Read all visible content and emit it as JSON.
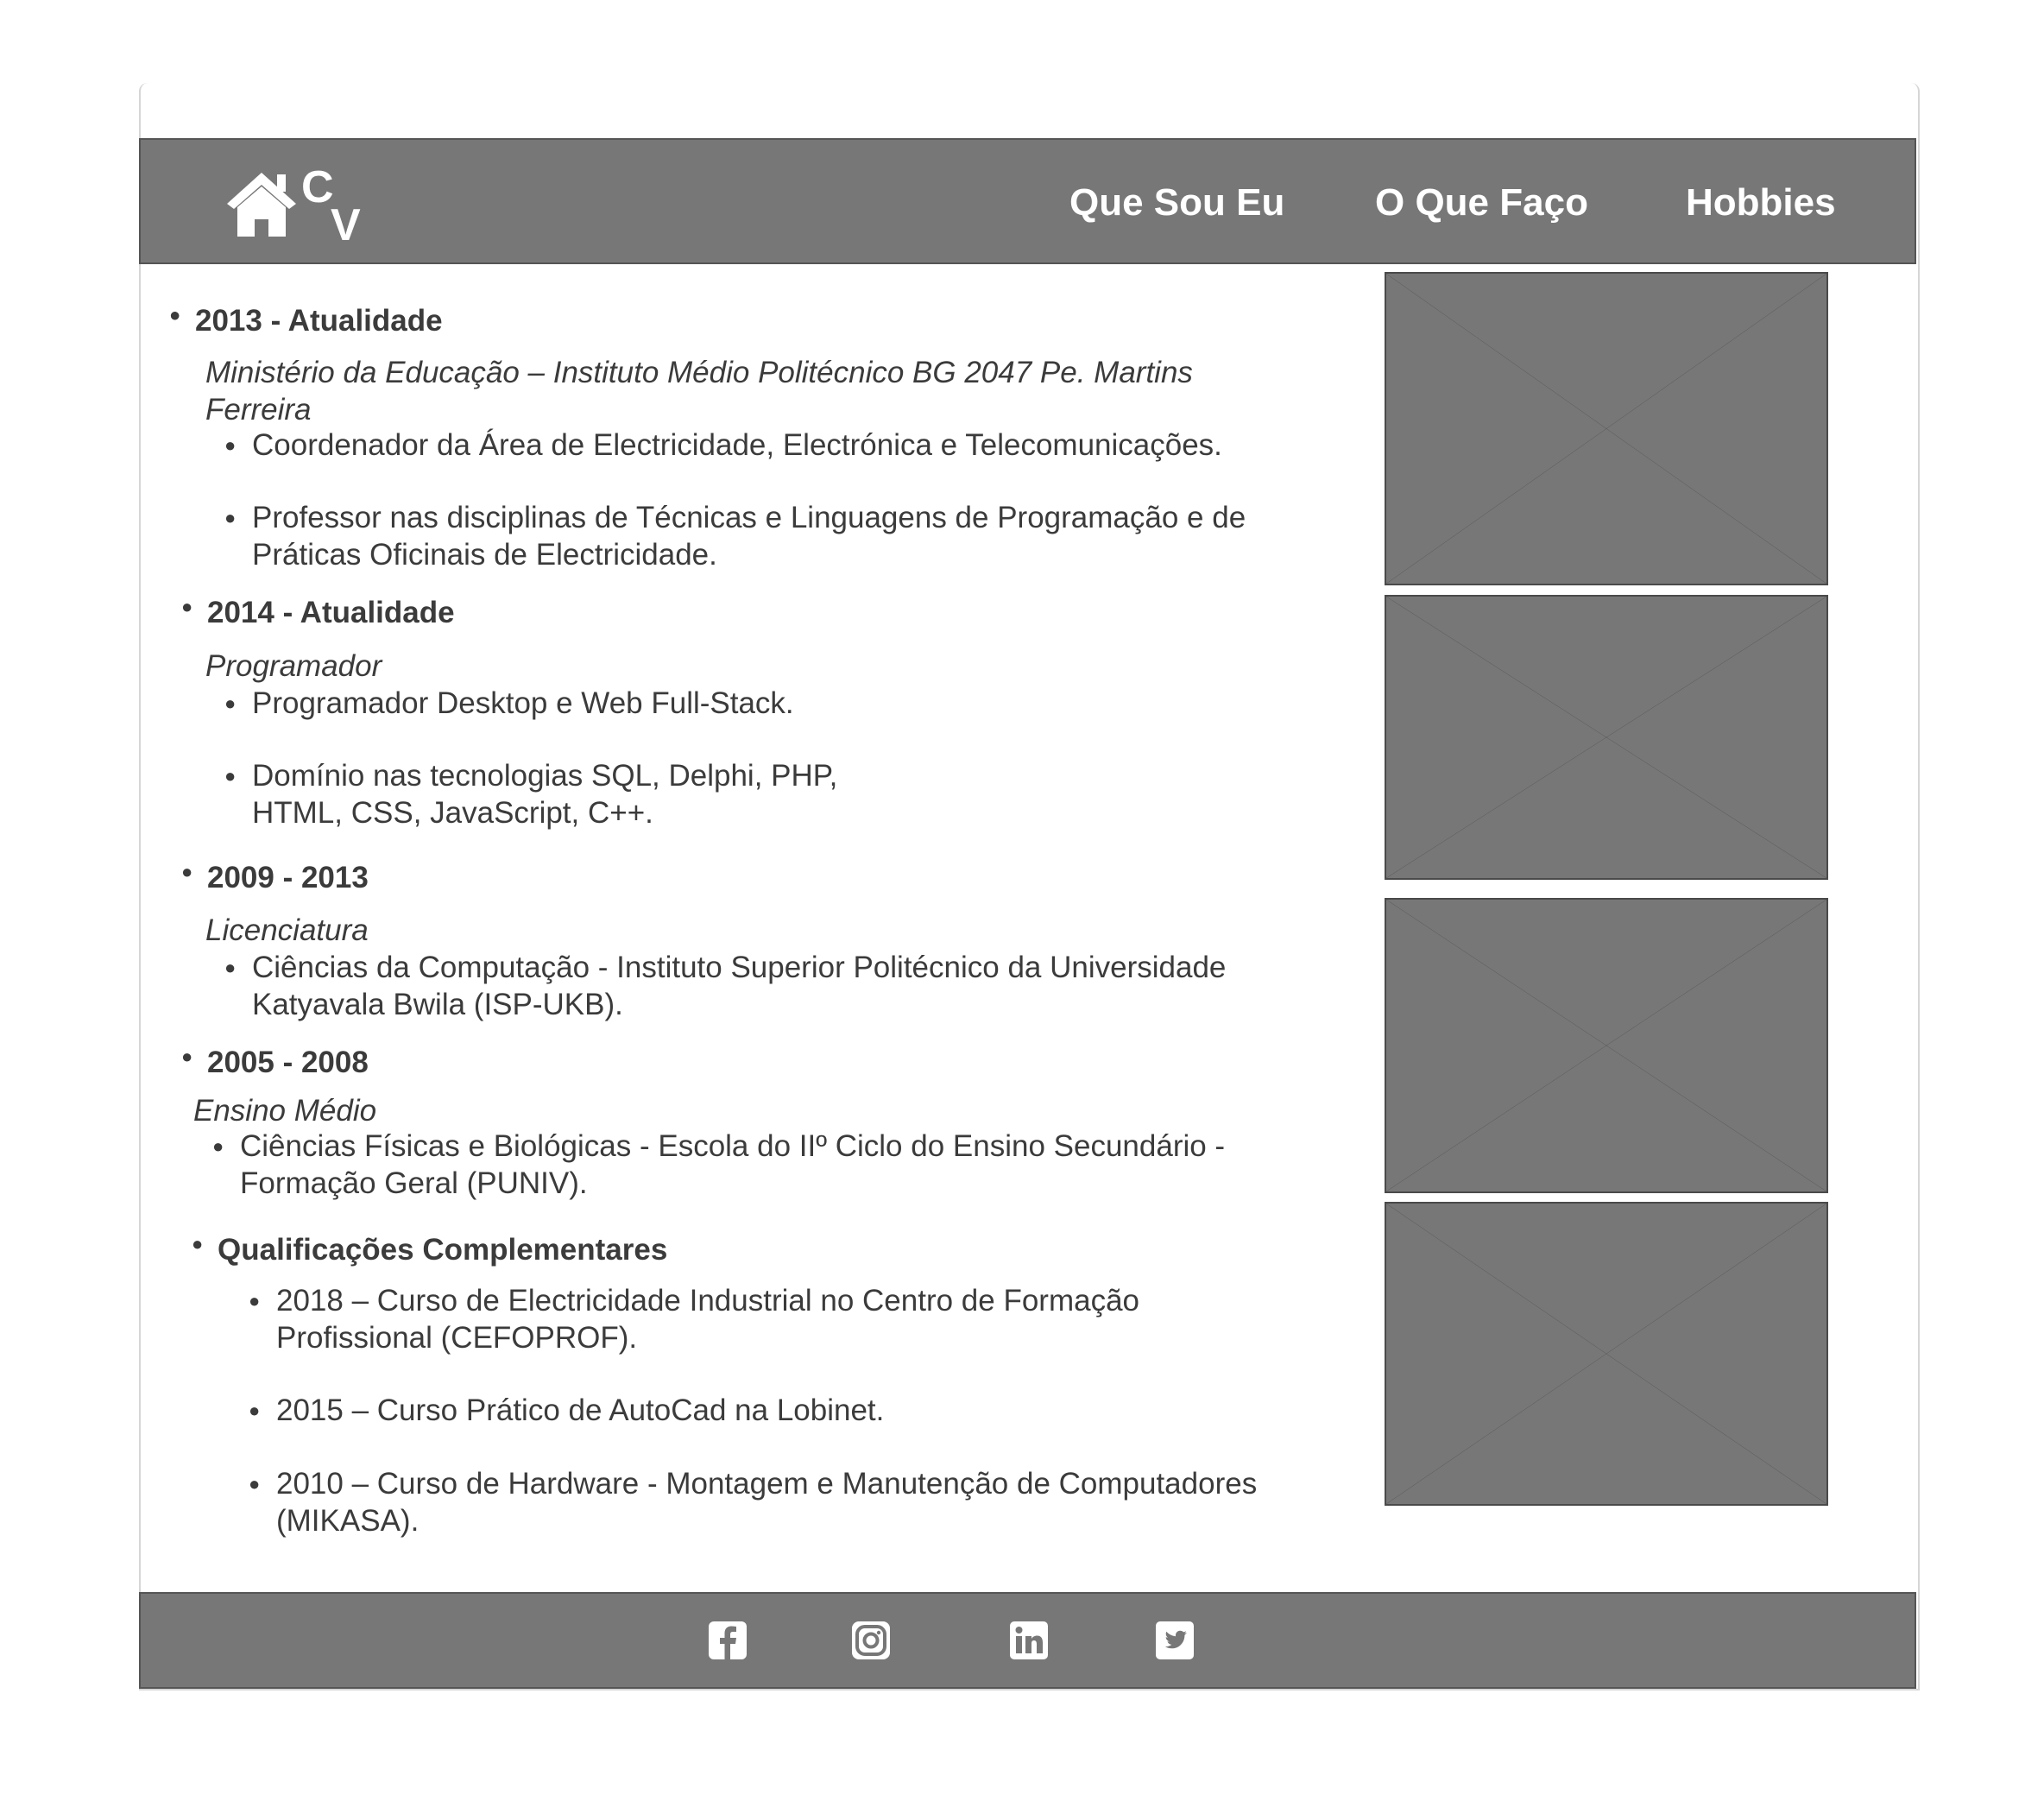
{
  "nav": {
    "logo_text_c": "C",
    "logo_text_v": "V",
    "items": [
      "Que Sou Eu",
      "O Que Faço",
      "Hobbies"
    ]
  },
  "entries": [
    {
      "period": "2013 - Atualidade",
      "subtitle_line1": "Ministério da Educação – Instituto Médio Politécnico BG 2047 Pe. Martins",
      "subtitle_line2": "Ferreira",
      "items": [
        "Coordenador da Área de Electricidade, Electrónica e Telecomunicações.",
        "Professor nas disciplinas de Técnicas e Linguagens de Programação e de",
        "Práticas Oficinais de Electricidade."
      ]
    },
    {
      "period": "2014 - Atualidade",
      "subtitle": "Programador",
      "items": [
        "Programador Desktop e Web Full-Stack.",
        "Domínio nas tecnologias SQL, Delphi, PHP,",
        "HTML, CSS, JavaScript, C++."
      ]
    },
    {
      "period": "2009 - 2013",
      "subtitle": "Licenciatura",
      "items": [
        "Ciências da Computação - Instituto Superior Politécnico da Universidade",
        "Katyavala Bwila (ISP-UKB)."
      ]
    },
    {
      "period": "2005 - 2008",
      "subtitle": "Ensino Médio",
      "items": [
        "Ciências Físicas e Biológicas - Escola do IIº Ciclo do Ensino Secundário -",
        "Formação Geral (PUNIV)."
      ]
    },
    {
      "period": "Qualificações Complementares",
      "items": [
        "2018 – Curso de Electricidade Industrial no Centro de Formação",
        "Profissional (CEFOPROF).",
        "2015 – Curso Prático de AutoCad na Lobinet.",
        "2010 – Curso de Hardware - Montagem e Manutenção de Computadores",
        "(MIKASA)."
      ]
    }
  ],
  "footer": {
    "icons": [
      "facebook-icon",
      "instagram-icon",
      "linkedin-icon",
      "twitter-icon"
    ]
  },
  "colors": {
    "header_bg": "#777777",
    "titlebar_bg": "#dddddd",
    "text": "#3b3b3b",
    "placeholder_bg": "#777777"
  }
}
